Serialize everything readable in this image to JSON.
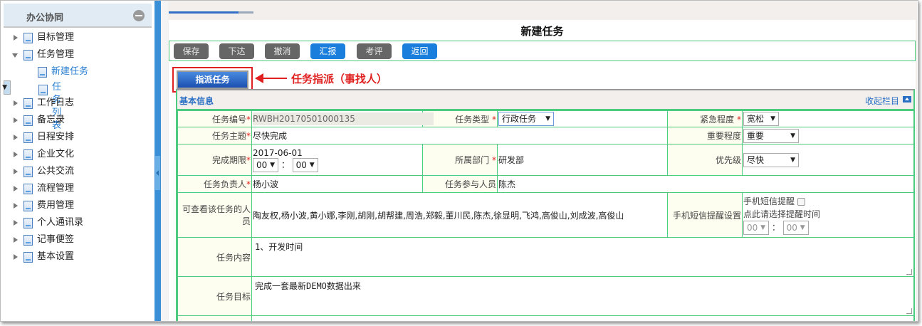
{
  "sidebar": {
    "title": "办公协同",
    "items": [
      {
        "label": "目标管理",
        "level": 0,
        "expanded": false
      },
      {
        "label": "任务管理",
        "level": 0,
        "expanded": true
      },
      {
        "label": "新建任务",
        "level": 1
      },
      {
        "label": "任务列表",
        "level": 1,
        "selected": true
      },
      {
        "label": "工作日志",
        "level": 0
      },
      {
        "label": "备忘录",
        "level": 0
      },
      {
        "label": "日程安排",
        "level": 0
      },
      {
        "label": "企业文化",
        "level": 0
      },
      {
        "label": "公共交流",
        "level": 0
      },
      {
        "label": "流程管理",
        "level": 0
      },
      {
        "label": "费用管理",
        "level": 0
      },
      {
        "label": "个人通讯录",
        "level": 0
      },
      {
        "label": "记事便签",
        "level": 0
      },
      {
        "label": "基本设置",
        "level": 0
      }
    ]
  },
  "main": {
    "progress_percent": 82,
    "title": "新建任务",
    "toolbar": [
      "保存",
      "下达",
      "撤消",
      "汇报",
      "考评",
      "返回"
    ],
    "assign_button": "指派任务",
    "annotation": "任务指派（事找人）",
    "section_title": "基本信息",
    "collapse_label": "收起栏目",
    "form": {
      "task_no_label": "任务编号",
      "task_no": "RWBH20170501000135",
      "task_type_label": "任务类型",
      "task_type": "行政任务",
      "urgency_label": "紧急程度",
      "urgency": "宽松",
      "subject_label": "任务主题",
      "subject": "尽快完成",
      "importance_label": "重要程度",
      "importance": "重要",
      "deadline_label": "完成期限",
      "deadline_date": "2017-06-01",
      "deadline_hour": "00",
      "deadline_minute": "00",
      "dept_label": "所属部门",
      "dept": "研发部",
      "priority_label": "优先级",
      "priority": "尽快",
      "owner_label": "任务负责人",
      "owner": "杨小波",
      "participants_label": "任务参与人员",
      "participants": "陈杰",
      "viewers_label": "可查看该任务的人员",
      "viewers": "陶友权,杨小波,黄小娜,李刚,胡刚,胡帮建,周浩,郑毅,董川民,陈杰,徐显明,飞鸿,高俊山,刘成波,高俊山",
      "sms_label": "手机短信提醒设置",
      "sms_check_label": "手机短信提醒",
      "sms_hint": "点此请选择提醒时间",
      "sms_hour": "00",
      "sms_minute": "00",
      "content_label": "任务内容",
      "content": "1、开发时间",
      "goal_label": "任务目标",
      "goal": "完成一套最新DEMO数据出来"
    }
  },
  "colors": {
    "accent": "#1a7fdc",
    "border": "#4ccb7e",
    "annotation": "#e02020"
  }
}
